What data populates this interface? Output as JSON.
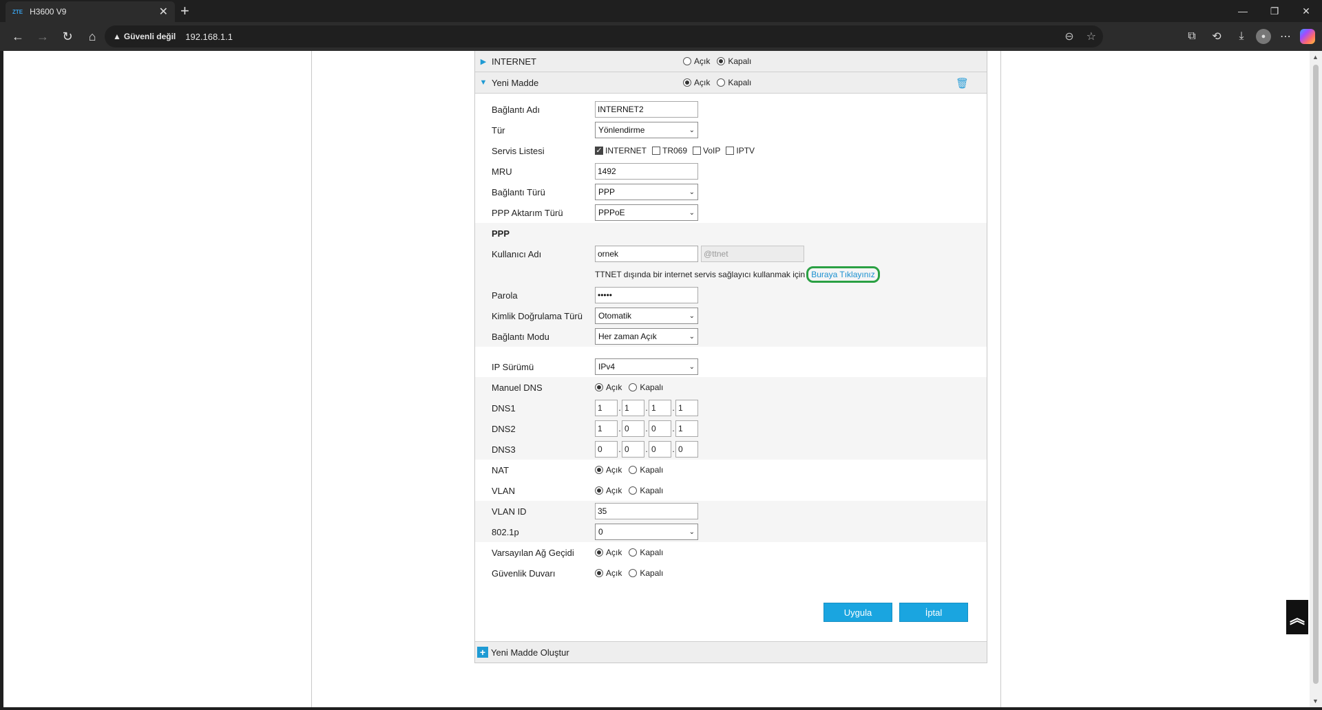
{
  "browser": {
    "tab_title": "H3600 V9",
    "favicon_text": "ZTE",
    "security_label": "Güvenli değil",
    "url": "192.168.1.1"
  },
  "sections": {
    "internet": {
      "label": "INTERNET",
      "on": "Açık",
      "off": "Kapalı",
      "selected": "off"
    },
    "new_item": {
      "label": "Yeni Madde",
      "on": "Açık",
      "off": "Kapalı",
      "selected": "on"
    }
  },
  "form": {
    "connection_name": {
      "label": "Bağlantı Adı",
      "value": "INTERNET2"
    },
    "type": {
      "label": "Tür",
      "value": "Yönlendirme"
    },
    "service_list": {
      "label": "Servis Listesi",
      "items": [
        "INTERNET",
        "TR069",
        "VoIP",
        "IPTV"
      ],
      "checked": [
        "INTERNET"
      ]
    },
    "mru": {
      "label": "MRU",
      "value": "1492"
    },
    "connection_type": {
      "label": "Bağlantı Türü",
      "value": "PPP"
    },
    "ppp_transfer_type": {
      "label": "PPP Aktarım Türü",
      "value": "PPPoE"
    },
    "ppp_heading": "PPP",
    "username": {
      "label": "Kullanıcı Adı",
      "value": "ornek",
      "suffix_placeholder": "@ttnet"
    },
    "isp_note": "TTNET dışında bir internet servis sağlayıcı kullanmak için",
    "isp_link": "Buraya Tıklayınız",
    "password": {
      "label": "Parola",
      "value": "•••••"
    },
    "auth_type": {
      "label": "Kimlik Doğrulama Türü",
      "value": "Otomatik"
    },
    "connection_mode": {
      "label": "Bağlantı Modu",
      "value": "Her zaman Açık"
    },
    "ip_version": {
      "label": "IP Sürümü",
      "value": "IPv4"
    },
    "manual_dns": {
      "label": "Manuel DNS",
      "on": "Açık",
      "off": "Kapalı"
    },
    "dns1": {
      "label": "DNS1",
      "octets": [
        "1",
        "1",
        "1",
        "1"
      ]
    },
    "dns2": {
      "label": "DNS2",
      "octets": [
        "1",
        "0",
        "0",
        "1"
      ]
    },
    "dns3": {
      "label": "DNS3",
      "octets": [
        "0",
        "0",
        "0",
        "0"
      ]
    },
    "nat": {
      "label": "NAT",
      "on": "Açık",
      "off": "Kapalı"
    },
    "vlan": {
      "label": "VLAN",
      "on": "Açık",
      "off": "Kapalı"
    },
    "vlan_id": {
      "label": "VLAN ID",
      "value": "35"
    },
    "priority": {
      "label": "802.1p",
      "value": "0"
    },
    "default_gateway": {
      "label": "Varsayılan Ağ Geçidi",
      "on": "Açık",
      "off": "Kapalı"
    },
    "firewall": {
      "label": "Güvenlik Duvarı",
      "on": "Açık",
      "off": "Kapalı"
    }
  },
  "buttons": {
    "apply": "Uygula",
    "cancel": "İptal"
  },
  "create_new": "Yeni Madde Oluştur",
  "colors": {
    "accent": "#1aa5e0",
    "highlight": "#2aa043"
  }
}
